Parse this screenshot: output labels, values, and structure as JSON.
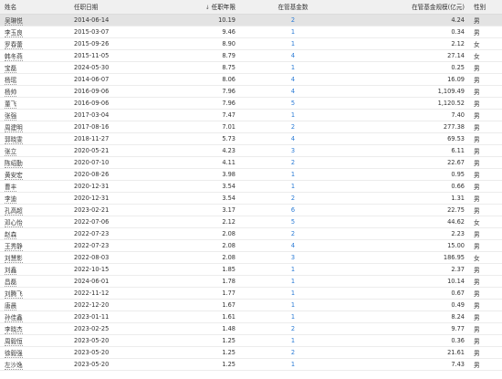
{
  "table": {
    "headers": {
      "name": "姓名",
      "date": "任职日期",
      "years": "任职年限",
      "count": "在管基金数",
      "scale": "在管基金规模(亿元)",
      "sex": "性别"
    },
    "sort_icon": "arrow-down-icon",
    "rows": [
      {
        "name": "吴琳悦",
        "date": "2014-06-14",
        "years": "10.19",
        "count": "2",
        "scale": "4.24",
        "sex": "男"
      },
      {
        "name": "李玉良",
        "date": "2015-03-07",
        "years": "9.46",
        "count": "1",
        "scale": "0.34",
        "sex": "男"
      },
      {
        "name": "罗春蕾",
        "date": "2015-09-26",
        "years": "8.90",
        "count": "1",
        "scale": "2.12",
        "sex": "女"
      },
      {
        "name": "韩冬燕",
        "date": "2015-11-05",
        "years": "8.79",
        "count": "4",
        "scale": "27.14",
        "sex": "女"
      },
      {
        "name": "宝磊",
        "date": "2024-05-30",
        "years": "8.75",
        "count": "1",
        "scale": "0.25",
        "sex": "男"
      },
      {
        "name": "杨瑶",
        "date": "2014-06-07",
        "years": "8.06",
        "count": "4",
        "scale": "16.09",
        "sex": "男"
      },
      {
        "name": "杨帅",
        "date": "2016-09-06",
        "years": "7.96",
        "count": "4",
        "scale": "1,109.49",
        "sex": "男"
      },
      {
        "name": "董飞",
        "date": "2016-09-06",
        "years": "7.96",
        "count": "5",
        "scale": "1,120.52",
        "sex": "男"
      },
      {
        "name": "张强",
        "date": "2017-03-04",
        "years": "7.47",
        "count": "1",
        "scale": "7.40",
        "sex": "男"
      },
      {
        "name": "周建明",
        "date": "2017-08-16",
        "years": "7.01",
        "count": "2",
        "scale": "277.38",
        "sex": "男"
      },
      {
        "name": "郭晓雯",
        "date": "2018-11-27",
        "years": "5.73",
        "count": "4",
        "scale": "69.53",
        "sex": "男"
      },
      {
        "name": "张立",
        "date": "2020-05-21",
        "years": "4.23",
        "count": "3",
        "scale": "6.11",
        "sex": "男"
      },
      {
        "name": "陈绍勤",
        "date": "2020-07-10",
        "years": "4.11",
        "count": "2",
        "scale": "22.67",
        "sex": "男"
      },
      {
        "name": "黄安宏",
        "date": "2020-08-26",
        "years": "3.98",
        "count": "1",
        "scale": "0.95",
        "sex": "男"
      },
      {
        "name": "曹丰",
        "date": "2020-12-31",
        "years": "3.54",
        "count": "1",
        "scale": "0.66",
        "sex": "男"
      },
      {
        "name": "李迪",
        "date": "2020-12-31",
        "years": "3.54",
        "count": "2",
        "scale": "1.31",
        "sex": "男"
      },
      {
        "name": "孔高超",
        "date": "2023-02-21",
        "years": "3.17",
        "count": "6",
        "scale": "22.75",
        "sex": "男"
      },
      {
        "name": "邓心怡",
        "date": "2022-07-06",
        "years": "2.12",
        "count": "5",
        "scale": "44.62",
        "sex": "女"
      },
      {
        "name": "赵森",
        "date": "2022-07-23",
        "years": "2.08",
        "count": "2",
        "scale": "2.23",
        "sex": "男"
      },
      {
        "name": "王秀静",
        "date": "2022-07-23",
        "years": "2.08",
        "count": "4",
        "scale": "15.00",
        "sex": "男"
      },
      {
        "name": "刘慧影",
        "date": "2022-08-03",
        "years": "2.08",
        "count": "3",
        "scale": "186.95",
        "sex": "女"
      },
      {
        "name": "刘鑫",
        "date": "2022-10-15",
        "years": "1.85",
        "count": "1",
        "scale": "2.37",
        "sex": "男"
      },
      {
        "name": "昌磊",
        "date": "2024-06-01",
        "years": "1.78",
        "count": "1",
        "scale": "10.14",
        "sex": "男"
      },
      {
        "name": "刘腾飞",
        "date": "2022-11-12",
        "years": "1.77",
        "count": "1",
        "scale": "0.67",
        "sex": "男"
      },
      {
        "name": "唐晨",
        "date": "2022-12-20",
        "years": "1.67",
        "count": "1",
        "scale": "0.49",
        "sex": "男"
      },
      {
        "name": "孙佳鑫",
        "date": "2023-01-11",
        "years": "1.61",
        "count": "1",
        "scale": "8.24",
        "sex": "男"
      },
      {
        "name": "李晓杰",
        "date": "2023-02-25",
        "years": "1.48",
        "count": "2",
        "scale": "9.77",
        "sex": "男"
      },
      {
        "name": "周毅恒",
        "date": "2023-05-20",
        "years": "1.25",
        "count": "1",
        "scale": "0.36",
        "sex": "男"
      },
      {
        "name": "徐毅强",
        "date": "2023-05-20",
        "years": "1.25",
        "count": "2",
        "scale": "21.61",
        "sex": "男"
      },
      {
        "name": "左沙逸",
        "date": "2023-05-20",
        "years": "1.25",
        "count": "1",
        "scale": "7.43",
        "sex": "男"
      }
    ]
  }
}
